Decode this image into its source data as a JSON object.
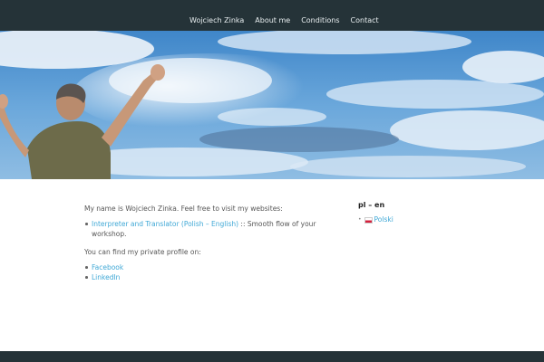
{
  "nav": {
    "items": [
      {
        "label": "Wojciech Zinka"
      },
      {
        "label": "About me"
      },
      {
        "label": "Conditions"
      },
      {
        "label": "Contact"
      }
    ]
  },
  "main": {
    "intro": "My name is Wojciech Zinka. Feel free to visit my websites:",
    "websites": [
      {
        "link": "Interpreter and Translator (Polish – English)",
        "suffix": " :: Smooth flow of your workshop."
      }
    ],
    "profile_intro": "You can find my private profile on:",
    "profiles": [
      {
        "link": "Facebook"
      },
      {
        "link": "LinkedIn"
      }
    ]
  },
  "sidebar": {
    "title": "pl – en",
    "languages": [
      {
        "label": "Polski",
        "flag_colors": [
          "#ffffff",
          "#d4213d"
        ]
      }
    ]
  },
  "colors": {
    "nav_bg": "#253338",
    "link": "#3fa8d6",
    "footer_bg": "#253338"
  }
}
